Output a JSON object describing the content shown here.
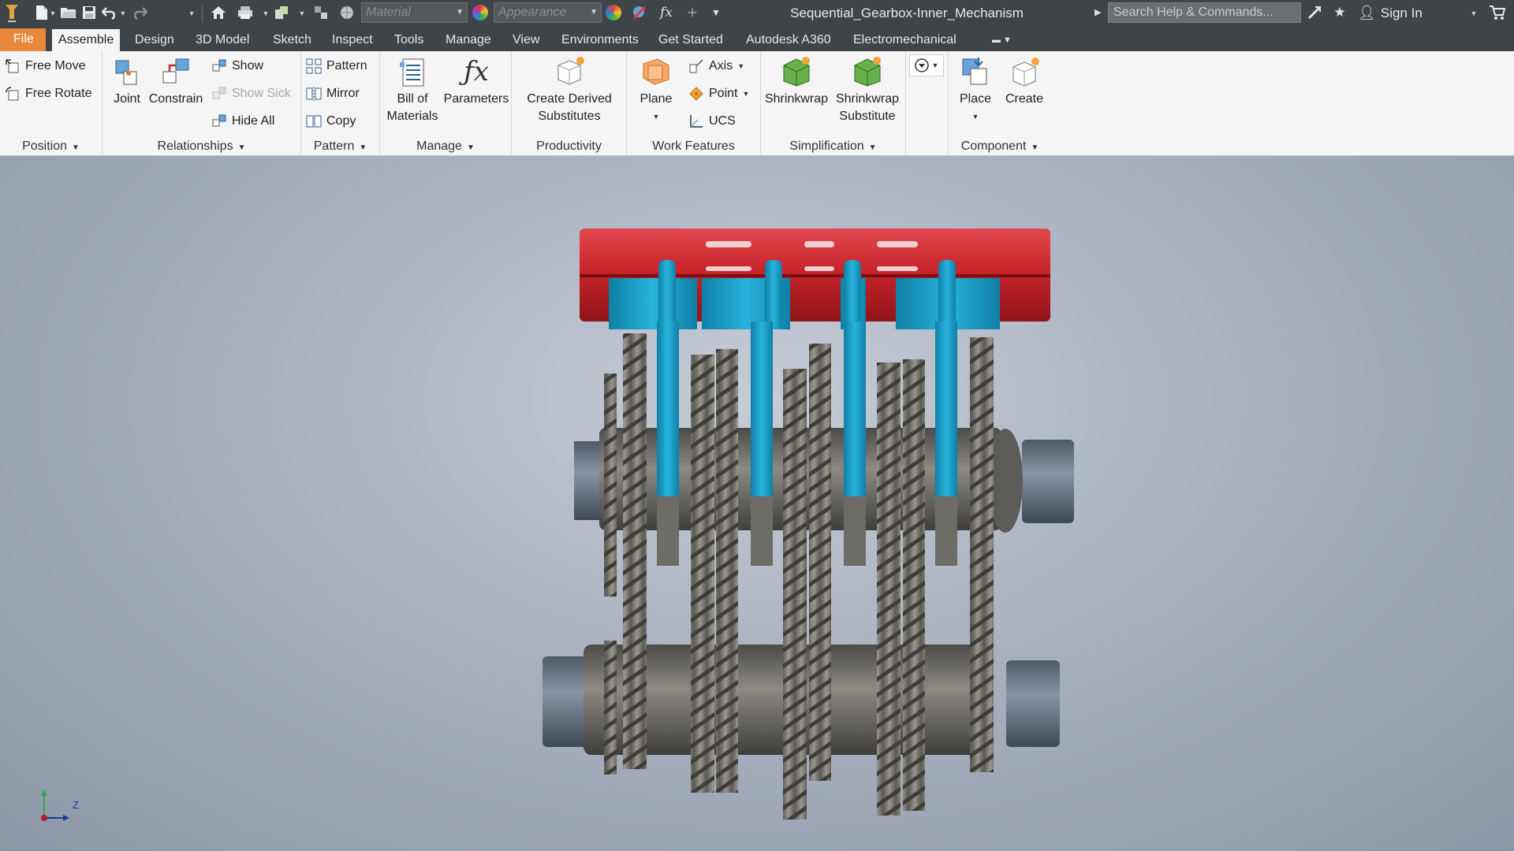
{
  "app": {
    "document_title": "Sequential_Gearbox-Inner_Mechanism",
    "material_placeholder": "Material",
    "appearance_placeholder": "Appearance",
    "search_placeholder": "Search Help & Commands...",
    "sign_in": "Sign In"
  },
  "menu_tabs": {
    "file": "File",
    "assemble": "Assemble",
    "design": "Design",
    "model3d": "3D Model",
    "sketch": "Sketch",
    "inspect": "Inspect",
    "tools": "Tools",
    "manage": "Manage",
    "view": "View",
    "environments": "Environments",
    "get_started": "Get Started",
    "a360": "Autodesk A360",
    "electromechanical": "Electromechanical",
    "active": "Assemble"
  },
  "ribbon": {
    "position": {
      "free_move": "Free Move",
      "free_rotate": "Free Rotate",
      "label": "Position"
    },
    "relationships": {
      "joint": "Joint",
      "constrain": "Constrain",
      "show": "Show",
      "show_sick": "Show Sick",
      "hide_all": "Hide All",
      "label": "Relationships"
    },
    "pattern": {
      "pattern": "Pattern",
      "mirror": "Mirror",
      "copy": "Copy",
      "label": "Pattern"
    },
    "manage": {
      "bom_line1": "Bill of",
      "bom_line2": "Materials",
      "parameters": "Parameters",
      "label": "Manage"
    },
    "productivity": {
      "cds_line1": "Create Derived",
      "cds_line2": "Substitutes",
      "label": "Productivity"
    },
    "work_features": {
      "plane": "Plane",
      "axis": "Axis",
      "point": "Point",
      "ucs": "UCS",
      "label": "Work Features"
    },
    "simplification": {
      "shrinkwrap": "Shrinkwrap",
      "sws_line1": "Shrinkwrap",
      "sws_line2": "Substitute",
      "label": "Simplification"
    },
    "component": {
      "place": "Place",
      "create": "Create",
      "label": "Component"
    }
  },
  "viewport": {
    "triad_axis_label": "Z",
    "colors": {
      "selector_rail": "#c8242b",
      "shift_forks": "#1aa0c8",
      "gears": "#8a8782",
      "shaft_ends": "#6c7a8a"
    }
  },
  "icons": {
    "titlebar": [
      "app-logo-icon",
      "new-file-icon",
      "open-icon",
      "save-icon",
      "undo-icon",
      "redo-icon",
      "home-icon",
      "print-icon",
      "update-icon",
      "select-icon",
      "globe-icon",
      "appearance-icon",
      "clear-override-icon",
      "fx-icon",
      "plus-icon",
      "customize-icon",
      "exchange-icon",
      "favorites-icon",
      "user-icon",
      "cart-icon"
    ]
  }
}
